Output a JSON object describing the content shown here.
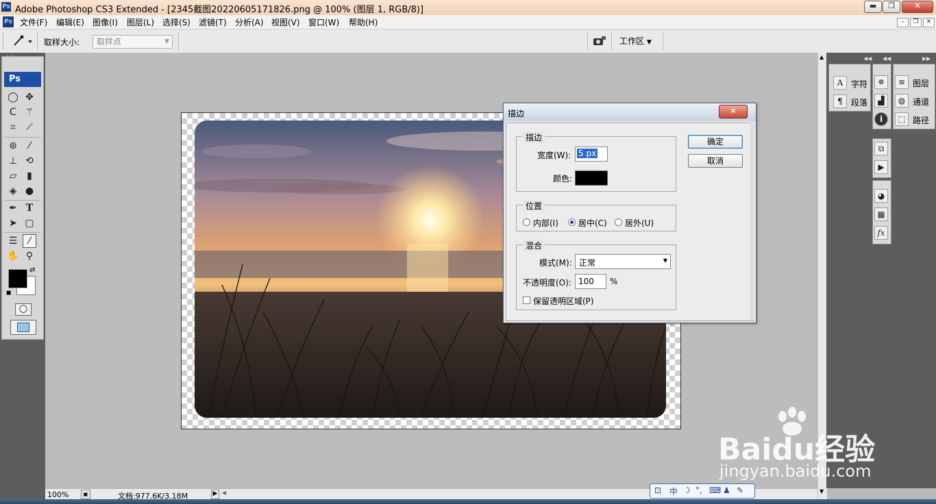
{
  "window": {
    "title": "Adobe Photoshop CS3 Extended - [2345截图20220605171826.png @ 100% (图层 1, RGB/8)]",
    "logo": "Ps"
  },
  "menu": {
    "items": [
      "文件(F)",
      "编辑(E)",
      "图像(I)",
      "图层(L)",
      "选择(S)",
      "滤镜(T)",
      "分析(A)",
      "视图(V)",
      "窗口(W)",
      "帮助(H)"
    ]
  },
  "options": {
    "sample_size_label": "取样大小:",
    "sample_size_value": "取样点",
    "workspace_label": "工作区"
  },
  "toolbox": {
    "logo": "Ps"
  },
  "status": {
    "zoom": "100%",
    "doc_info": "文档:977.6K/3.18M"
  },
  "panels": {
    "group1": [
      "字符",
      "段落"
    ],
    "group3": [
      "图层",
      "通道",
      "路径"
    ]
  },
  "dialog": {
    "title": "描边",
    "stroke_group": "描边",
    "width_label": "宽度(W):",
    "width_value": "5 px",
    "color_label": "颜色:",
    "stroke_color": "#000000",
    "location_group": "位置",
    "location_options": [
      "内部(I)",
      "居中(C)",
      "居外(U)"
    ],
    "location_selected": "居中(C)",
    "blend_group": "混合",
    "mode_label": "模式(M):",
    "mode_value": "正常",
    "opacity_label": "不透明度(O):",
    "opacity_value": "100",
    "opacity_unit": "%",
    "preserve_label": "保留透明区域(P)",
    "ok_label": "确定",
    "cancel_label": "取消"
  },
  "watermark": {
    "brand": "Baidu经验",
    "url": "jingyan.baidu.com"
  }
}
